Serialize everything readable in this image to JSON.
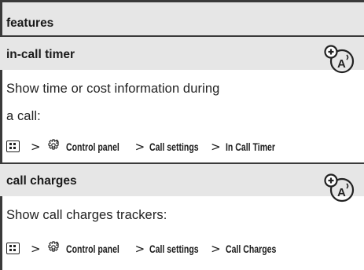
{
  "table": {
    "header_label": "features",
    "rows": [
      {
        "title": "in-call timer",
        "desc_lines": [
          "Show time or cost information during",
          "a call:"
        ],
        "path": {
          "key_icon": "menu-key-icon",
          "separator": ">",
          "settings_icon": "settings-icon",
          "items": [
            "Control panel",
            "Call settings",
            "In Call Timer"
          ]
        },
        "badge_icon": "network-feature-icon"
      },
      {
        "title": "call charges",
        "desc_lines": [
          "Show call charges trackers:"
        ],
        "path": {
          "key_icon": "menu-key-icon",
          "separator": ">",
          "settings_icon": "settings-icon",
          "items": [
            "Control panel",
            "Call settings",
            "Call Charges"
          ]
        },
        "badge_icon": "network-feature-icon"
      }
    ]
  }
}
